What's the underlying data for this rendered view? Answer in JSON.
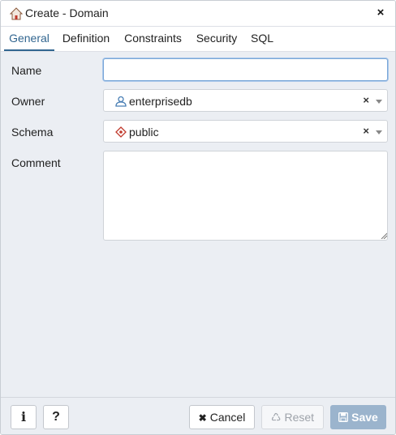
{
  "dialog": {
    "title": "Create - Domain",
    "close_symbol": "×"
  },
  "tabs": [
    {
      "label": "General",
      "active": true
    },
    {
      "label": "Definition",
      "active": false
    },
    {
      "label": "Constraints",
      "active": false
    },
    {
      "label": "Security",
      "active": false
    },
    {
      "label": "SQL",
      "active": false
    }
  ],
  "form": {
    "name": {
      "label": "Name",
      "value": ""
    },
    "owner": {
      "label": "Owner",
      "value": "enterprisedb",
      "icon": "user-role-icon"
    },
    "schema": {
      "label": "Schema",
      "value": "public",
      "icon": "schema-icon"
    },
    "comment": {
      "label": "Comment",
      "value": ""
    },
    "clear_symbol": "×"
  },
  "footer": {
    "info_symbol": "i",
    "help_symbol": "?",
    "cancel": {
      "label": "Cancel",
      "icon": "✖"
    },
    "reset": {
      "label": "Reset",
      "icon": "♺"
    },
    "save": {
      "label": "Save",
      "icon": "floppy-disk-icon"
    }
  },
  "colors": {
    "accent": "#326690",
    "background": "#ebeef3",
    "save_disabled": "#9bb4cd",
    "owner_icon": "#4a7fb5",
    "schema_icon": "#c0392b"
  }
}
